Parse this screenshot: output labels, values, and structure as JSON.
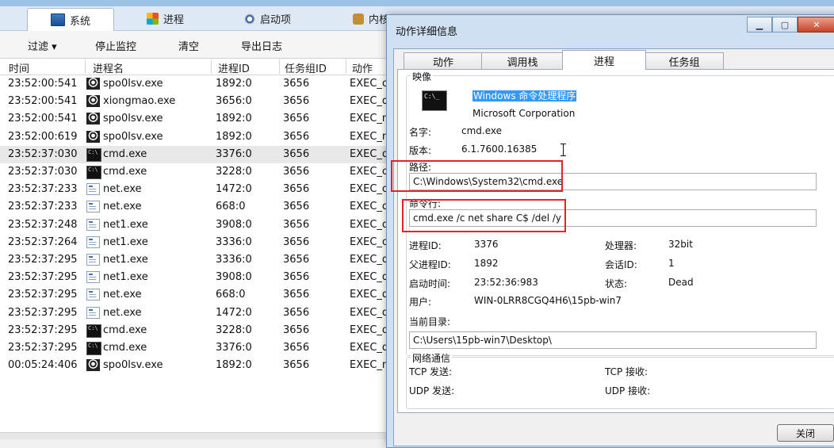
{
  "top_tabs": [
    {
      "label": "系统",
      "icon": "system-icon"
    },
    {
      "label": "进程",
      "icon": "windows-logo-icon"
    },
    {
      "label": "启动项",
      "icon": "gear-icon"
    },
    {
      "label": "内核",
      "icon": "kernel-icon"
    }
  ],
  "toolbar": {
    "filter": "过滤 ▾",
    "stop": "停止监控",
    "clear": "清空",
    "export": "导出日志"
  },
  "columns": [
    "时间",
    "进程名",
    "进程ID",
    "任务组ID",
    "动作"
  ],
  "rows": [
    {
      "time": "23:52:00:541",
      "name": "spo0lsv.exe",
      "pid": "1892:0",
      "gid": "3656",
      "action": "EXEC_cr",
      "icon": "exe"
    },
    {
      "time": "23:52:00:541",
      "name": "xiongmao.exe",
      "pid": "3656:0",
      "gid": "3656",
      "action": "EXEC_de",
      "icon": "exe"
    },
    {
      "time": "23:52:00:541",
      "name": "spo0lsv.exe",
      "pid": "1892:0",
      "gid": "3656",
      "action": "EXEC_m",
      "icon": "exe"
    },
    {
      "time": "23:52:00:619",
      "name": "spo0lsv.exe",
      "pid": "1892:0",
      "gid": "3656",
      "action": "EXEC_m",
      "icon": "exe"
    },
    {
      "time": "23:52:37:030",
      "name": "cmd.exe",
      "pid": "3376:0",
      "gid": "3656",
      "action": "EXEC_cr",
      "icon": "cmd",
      "selected": true
    },
    {
      "time": "23:52:37:030",
      "name": "cmd.exe",
      "pid": "3228:0",
      "gid": "3656",
      "action": "EXEC_cr",
      "icon": "cmd"
    },
    {
      "time": "23:52:37:233",
      "name": "net.exe",
      "pid": "1472:0",
      "gid": "3656",
      "action": "EXEC_cr",
      "icon": "net"
    },
    {
      "time": "23:52:37:233",
      "name": "net.exe",
      "pid": "668:0",
      "gid": "3656",
      "action": "EXEC_cr",
      "icon": "net"
    },
    {
      "time": "23:52:37:248",
      "name": "net1.exe",
      "pid": "3908:0",
      "gid": "3656",
      "action": "EXEC_cr",
      "icon": "net"
    },
    {
      "time": "23:52:37:264",
      "name": "net1.exe",
      "pid": "3336:0",
      "gid": "3656",
      "action": "EXEC_cr",
      "icon": "net"
    },
    {
      "time": "23:52:37:295",
      "name": "net1.exe",
      "pid": "3336:0",
      "gid": "3656",
      "action": "EXEC_de",
      "icon": "net"
    },
    {
      "time": "23:52:37:295",
      "name": "net1.exe",
      "pid": "3908:0",
      "gid": "3656",
      "action": "EXEC_de",
      "icon": "net"
    },
    {
      "time": "23:52:37:295",
      "name": "net.exe",
      "pid": "668:0",
      "gid": "3656",
      "action": "EXEC_de",
      "icon": "net"
    },
    {
      "time": "23:52:37:295",
      "name": "net.exe",
      "pid": "1472:0",
      "gid": "3656",
      "action": "EXEC_de",
      "icon": "net"
    },
    {
      "time": "23:52:37:295",
      "name": "cmd.exe",
      "pid": "3228:0",
      "gid": "3656",
      "action": "EXEC_de",
      "icon": "cmd"
    },
    {
      "time": "23:52:37:295",
      "name": "cmd.exe",
      "pid": "3376:0",
      "gid": "3656",
      "action": "EXEC_de",
      "icon": "cmd"
    },
    {
      "time": "00:05:24:406",
      "name": "spo0lsv.exe",
      "pid": "1892:0",
      "gid": "3656",
      "action": "EXEC_m",
      "icon": "exe"
    }
  ],
  "dialog": {
    "title": "动作详细信息",
    "tabs": [
      "动作",
      "调用栈",
      "进程",
      "任务组"
    ],
    "image_group": "映像",
    "image_desc": "Windows 命令处理程序",
    "image_company": "Microsoft Corporation",
    "name_label": "名字:",
    "name_value": "cmd.exe",
    "version_label": "版本:",
    "version_value": "6.1.7600.16385",
    "path_label": "路径:",
    "path_value": "C:\\Windows\\System32\\cmd.exe",
    "cmdline_label": "命令行:",
    "cmdline_value": "cmd.exe /c net share C$ /del /y",
    "pid_label": "进程ID:",
    "pid_value": "3376",
    "ppid_label": "父进程ID:",
    "ppid_value": "1892",
    "start_label": "启动时间:",
    "start_value": "23:52:36:983",
    "user_label": "用户:",
    "user_value": "WIN-0LRR8CGQ4H6\\15pb-win7",
    "cpu_label": "处理器:",
    "cpu_value": "32bit",
    "session_label": "会话ID:",
    "session_value": "1",
    "state_label": "状态:",
    "state_value": "Dead",
    "cwd_label": "当前目录:",
    "cwd_value": "C:\\Users\\15pb-win7\\Desktop\\",
    "net_group": "网络通信",
    "tcp_send": "TCP 发送:",
    "tcp_recv": "TCP 接收:",
    "udp_send": "UDP 发送:",
    "udp_recv": "UDP 接收:",
    "close_label": "关闭"
  }
}
